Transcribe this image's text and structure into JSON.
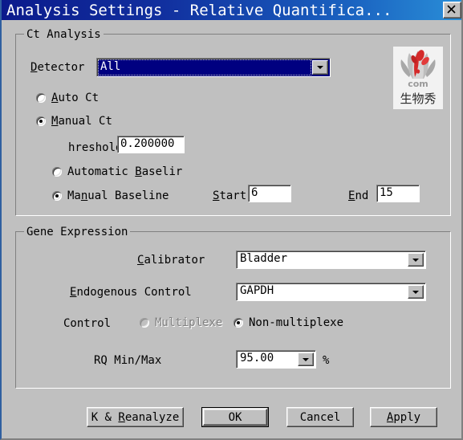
{
  "window": {
    "title": "Analysis Settings - Relative Quantifica...",
    "close_icon": "close-icon",
    "bg_color": "#c0c0c0",
    "titlebar_color_left": "#0b1a8c",
    "titlebar_color_right": "#2a8fd8"
  },
  "ct_analysis": {
    "group_title": "Ct Analysis",
    "detector": {
      "label": "Detecto",
      "label_full": "Detector",
      "value": "All",
      "focused": true
    },
    "auto_ct": {
      "label_mnemonic": "A",
      "label_rest": "uto Ct",
      "selected": false
    },
    "manual_ct": {
      "label_mnemonic": "M",
      "label_rest": "anual Ct",
      "selected": true
    },
    "threshold": {
      "label": "hreshold:",
      "label_full": "Threshold:",
      "value": "0.200000"
    },
    "automatic_baseline": {
      "label_pre": "Automatic ",
      "label_mnemonic": "B",
      "label_rest": "aselir",
      "label_full": "Automatic Baseline",
      "selected": false
    },
    "manual_baseline": {
      "label_pre": "Ma",
      "label_mnemonic": "n",
      "label_rest": "ual Baseline",
      "selected": true
    },
    "start": {
      "label_mnemonic": "S",
      "label_rest": "tart",
      "value": "6"
    },
    "end": {
      "label_mnemonic": "E",
      "label_rest": "nd",
      "value": "15"
    }
  },
  "gene_expression": {
    "group_title": "Gene Expression",
    "calibrator": {
      "label_mnemonic": "C",
      "label_rest": "alibrator",
      "value": "Bladder"
    },
    "endogenous_control": {
      "label_mnemonic": "E",
      "label_rest": "ndogenous Control",
      "value": "GAPDH"
    },
    "control": {
      "label": "Control",
      "multiplexed": {
        "label": "Multiplexe",
        "label_full": "Multiplexed",
        "selected": false,
        "disabled": true
      },
      "non_multiplexed": {
        "label": "Non-multiplexe",
        "label_full": "Non-multiplexed",
        "selected": true,
        "disabled": false
      }
    },
    "rq_min_max": {
      "label": "RQ Min/Max",
      "value": "95.00",
      "unit": "%"
    }
  },
  "buttons": {
    "ok_reanalyze": {
      "label": "OK & Reanalyze",
      "label_visible": "K & Reanalyze",
      "mnemonic": "R"
    },
    "ok": {
      "label": "OK"
    },
    "cancel": {
      "label": "Cancel"
    },
    "apply": {
      "label": "Apply",
      "mnemonic": "A"
    }
  },
  "watermark": {
    "name": "bio-com-logo",
    "wordmark": "bio",
    "domain_text": "com",
    "chinese_text": "生物秀",
    "accent_color": "#d42a2a"
  }
}
